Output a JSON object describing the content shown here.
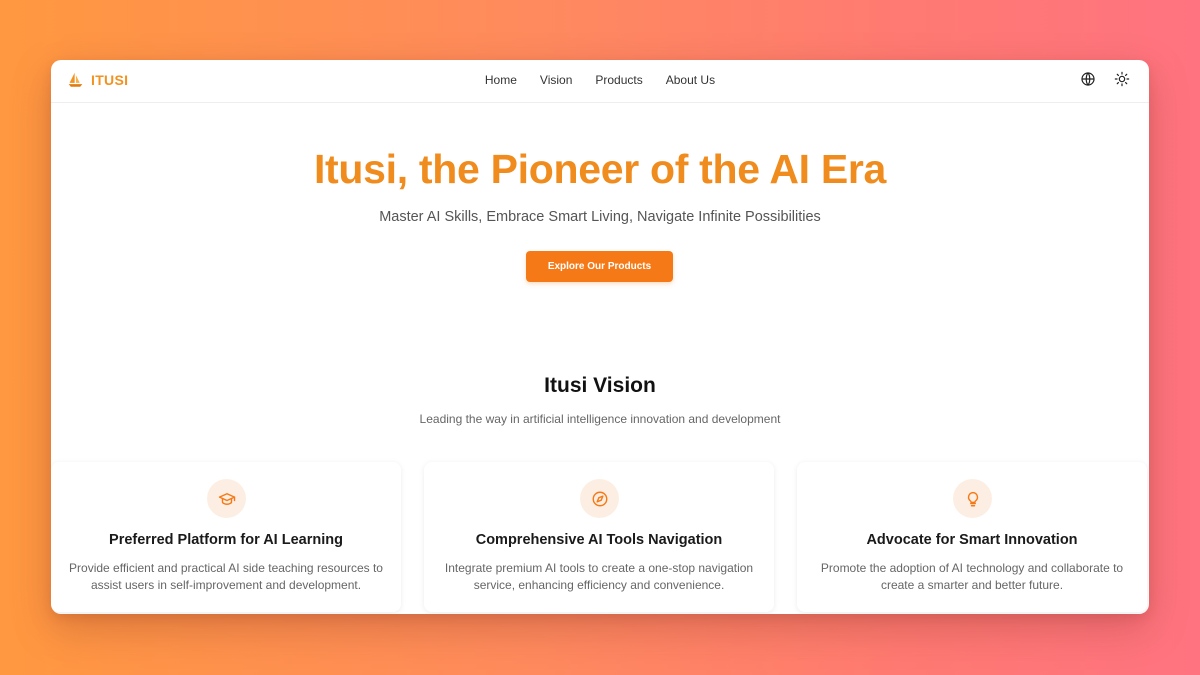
{
  "brand": {
    "name": "ITUSI",
    "icon": "sailboat-icon",
    "color": "#f39221"
  },
  "nav": {
    "items": [
      {
        "label": "Home"
      },
      {
        "label": "Vision"
      },
      {
        "label": "Products"
      },
      {
        "label": "About Us"
      }
    ]
  },
  "header_actions": {
    "language_icon": "globe-icon",
    "theme_icon": "sun-icon"
  },
  "hero": {
    "title": "Itusi, the Pioneer of the AI Era",
    "subtitle": "Master AI Skills, Embrace Smart Living, Navigate Infinite Possibilities",
    "cta_label": "Explore Our Products",
    "accent_color": "#f57a17"
  },
  "vision": {
    "title": "Itusi Vision",
    "subtitle": "Leading the way in artificial intelligence innovation and development",
    "cards": [
      {
        "icon": "graduation-cap-icon",
        "title": "Preferred Platform for AI Learning",
        "description": "Provide efficient and practical AI side teaching resources to assist users in self-improvement and development."
      },
      {
        "icon": "compass-icon",
        "title": "Comprehensive AI Tools Navigation",
        "description": "Integrate premium AI tools to create a one-stop navigation service, enhancing efficiency and convenience."
      },
      {
        "icon": "lightbulb-icon",
        "title": "Advocate for Smart Innovation",
        "description": "Promote the adoption of AI technology and collaborate to create a smarter and better future."
      }
    ]
  }
}
